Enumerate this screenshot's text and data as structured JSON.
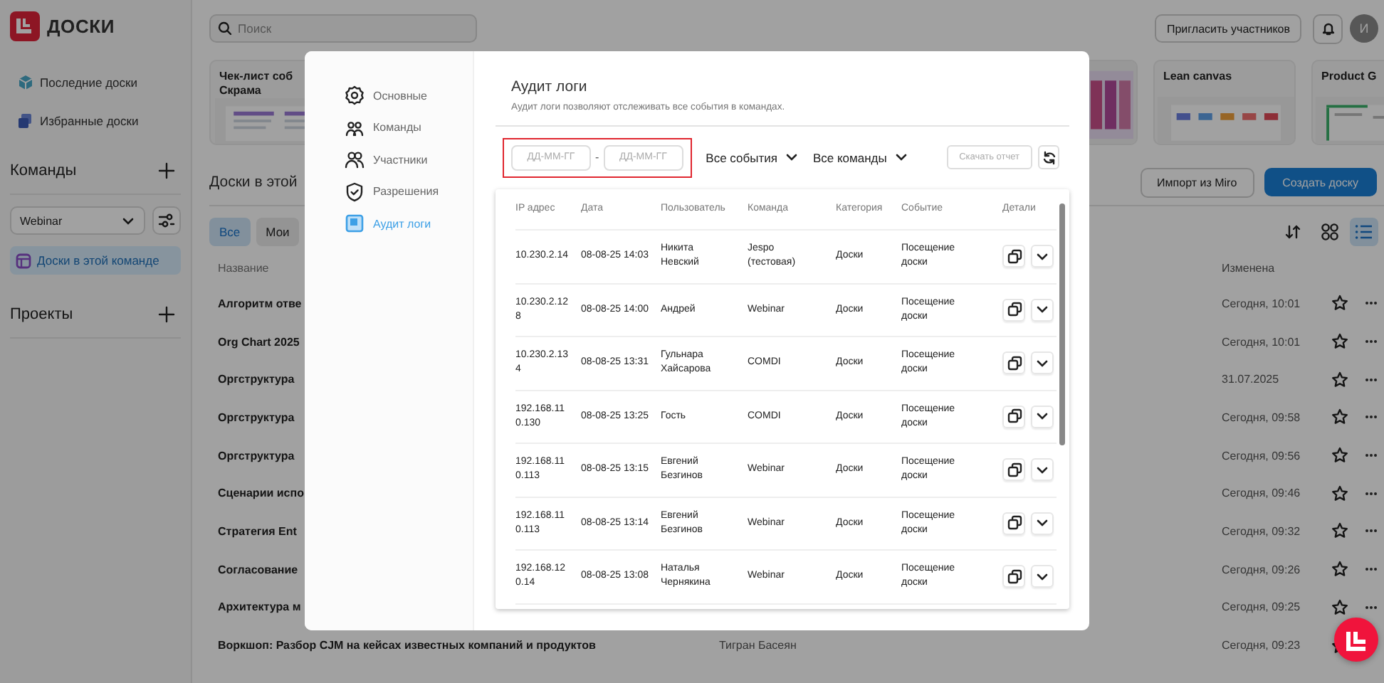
{
  "app": {
    "logo_text": "ДОСКИ"
  },
  "sidebar": {
    "nav": [
      {
        "label": "Последние доски"
      },
      {
        "label": "Избранные доски"
      }
    ],
    "teams_header": "Команды",
    "team_select": "Webinar",
    "team_items": [
      {
        "label": "Доски в этой команде",
        "selected": true
      }
    ],
    "projects_header": "Проекты"
  },
  "topbar": {
    "search_placeholder": "Поиск",
    "invite_button": "Пригласить участников",
    "avatar": "И"
  },
  "templates": [
    {
      "title_lines": [
        "Чек-лист соб",
        "Скрама"
      ]
    },
    {
      "kind": "picture"
    },
    {
      "title_lines": [
        "Lean canvas"
      ]
    },
    {
      "title_lines": [
        "Product G"
      ]
    }
  ],
  "boards": {
    "heading": "Доски в этой",
    "import_button": "Импорт из Miro",
    "create_button": "Создать доску",
    "filters": [
      {
        "label": "Все",
        "selected": true
      },
      {
        "label": "Мои",
        "selected": false
      }
    ],
    "view_modes": [
      {
        "selected": false
      },
      {
        "selected": true
      }
    ],
    "columns": [
      "Название",
      "Изменена"
    ],
    "rows": [
      {
        "name": "Алгоритм отве",
        "modified": "Сегодня, 10:01"
      },
      {
        "name": "Org Chart 2025",
        "modified": "Сегодня, 10:01"
      },
      {
        "name": "Оргструктура",
        "modified": "31.07.2025"
      },
      {
        "name": "Оргструктура",
        "modified": "Сегодня, 09:58"
      },
      {
        "name": "Оргструктура",
        "modified": "Сегодня, 09:56"
      },
      {
        "name": "Сценарии испо",
        "modified": "Сегодня, 09:46"
      },
      {
        "name": "Стратегия Ent",
        "modified": "Сегодня, 09:32"
      },
      {
        "name": "Согласование",
        "modified": "Сегодня, 09:26"
      },
      {
        "name": "Архитектура м",
        "modified": "Сегодня, 09:25"
      },
      {
        "name": "Воркшоп: Разбор CJM на кейсах известных компаний и продуктов",
        "owner": "Тигран Басеян",
        "modified": "Сегодня, 09:23"
      }
    ]
  },
  "modal": {
    "nav": [
      {
        "label": "Основные",
        "selected": false
      },
      {
        "label": "Команды",
        "selected": false
      },
      {
        "label": "Участники",
        "selected": false
      },
      {
        "label": "Разрешения",
        "selected": false
      },
      {
        "label": "Аудит логи",
        "selected": true
      }
    ],
    "title": "Аудит логи",
    "description": "Аудит логи позволяют отслеживать все события в командах.",
    "filters": {
      "date_from_placeholder": "ДД-ММ-ГГ",
      "separator": "-",
      "date_to_placeholder": "ДД-ММ-ГГ",
      "event_select": "Все события",
      "team_select": "Все команды",
      "download_button": {
        "label": "Скачать отчет",
        "disabled": true
      }
    },
    "table": {
      "columns": [
        "IP адрес",
        "Дата",
        "Пользователь",
        "Команда",
        "Категория",
        "Событие",
        "Детали"
      ],
      "rows": [
        {
          "ip": "10.230.2.14",
          "date": "08-08-25 14:03",
          "user": "Никита Невский",
          "team": "Jespo (тестовая)",
          "category": "Доски",
          "event": "Посещение доски"
        },
        {
          "ip": "10.230.2.128",
          "date": "08-08-25 14:00",
          "user": "Андрей",
          "team": "Webinar",
          "category": "Доски",
          "event": "Посещение доски"
        },
        {
          "ip": "10.230.2.134",
          "date": "08-08-25 13:31",
          "user": "Гульнара Хайсарова",
          "team": "COMDI",
          "category": "Доски",
          "event": "Посещение доски"
        },
        {
          "ip": "192.168.110.130",
          "date": "08-08-25 13:25",
          "user": "Гость",
          "team": "COMDI",
          "category": "Доски",
          "event": "Посещение доски"
        },
        {
          "ip": "192.168.110.113",
          "date": "08-08-25 13:15",
          "user": "Евгений Безгинов",
          "team": "Webinar",
          "category": "Доски",
          "event": "Посещение доски"
        },
        {
          "ip": "192.168.110.113",
          "date": "08-08-25 13:14",
          "user": "Евгений Безгинов",
          "team": "Webinar",
          "category": "Доски",
          "event": "Посещение доски"
        },
        {
          "ip": "192.168.120.14",
          "date": "08-08-25 13:08",
          "user": "Наталья Чернякина",
          "team": "Webinar",
          "category": "Доски",
          "event": "Посещение доски"
        }
      ]
    }
  }
}
